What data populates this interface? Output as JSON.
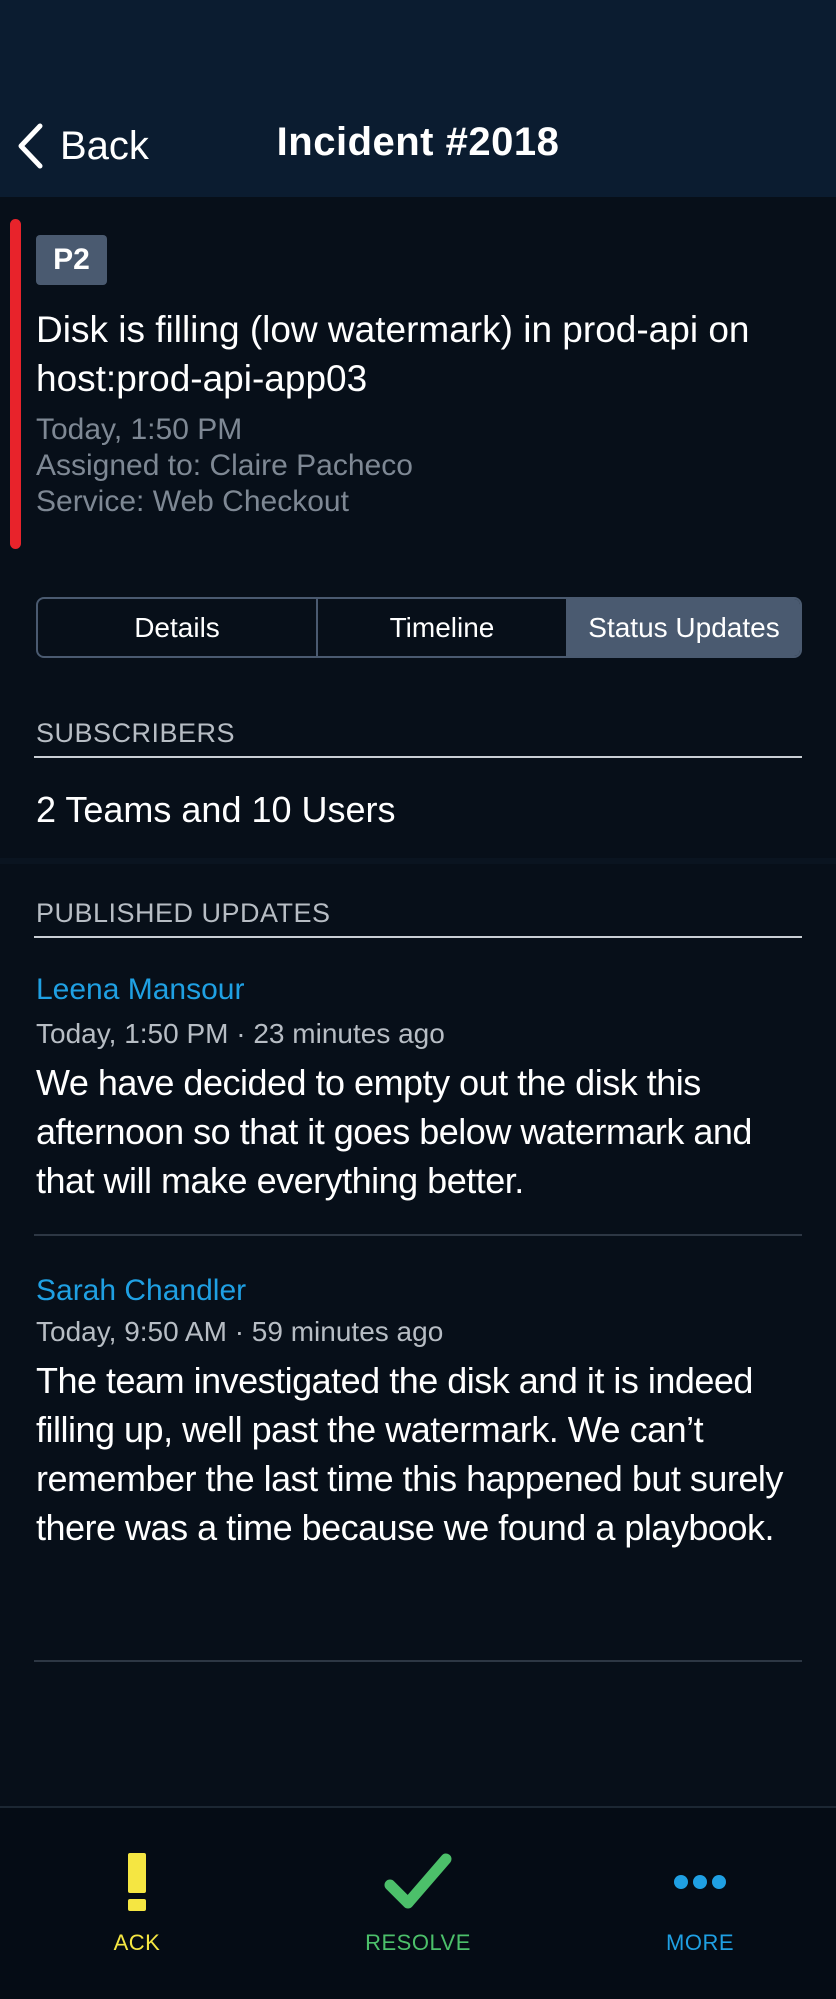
{
  "header": {
    "back_label": "Back",
    "title": "Incident #2018"
  },
  "incident": {
    "priority": "P2",
    "severity_color": "#e8232b",
    "title": "Disk is filling (low watermark) in prod-api on host:prod-api-app03",
    "time": "Today, 1:50 PM",
    "assigned": "Assigned to: Claire Pacheco",
    "service": "Service: Web Checkout"
  },
  "tabs": [
    {
      "label": "Details",
      "active": false
    },
    {
      "label": "Timeline",
      "active": false
    },
    {
      "label": "Status Updates",
      "active": true
    }
  ],
  "subscribers": {
    "heading": "SUBSCRIBERS",
    "summary": "2 Teams and 10 Users"
  },
  "published": {
    "heading": "PUBLISHED UPDATES",
    "updates": [
      {
        "author": "Leena Mansour",
        "timestamp": "Today, 1:50 PM · 23 minutes ago",
        "body": "We have decided to empty out the disk this afternoon so that it goes below watermark and that will make everything better."
      },
      {
        "author": "Sarah Chandler",
        "timestamp": "Today, 9:50 AM · 59 minutes ago",
        "body": "The team investigated the disk and it is indeed filling up, well past the watermark. We can’t remember the last time this happened but surely there was a time because we found a playbook."
      }
    ]
  },
  "actions": {
    "ack": {
      "label": "ACK",
      "icon": "exclamation-icon",
      "color": "#f5e642"
    },
    "resolve": {
      "label": "RESOLVE",
      "icon": "checkmark-icon",
      "color": "#4cc06a"
    },
    "more": {
      "label": "MORE",
      "icon": "ellipsis-icon",
      "color": "#1fa0e3"
    }
  },
  "colors": {
    "header_bg": "#0b1c30",
    "page_bg": "#070f19",
    "accent_link": "#1fa0e3"
  }
}
